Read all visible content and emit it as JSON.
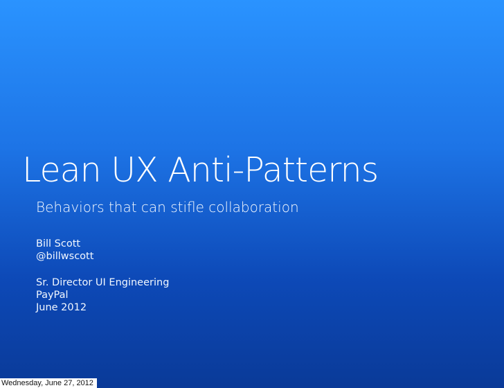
{
  "slide": {
    "title": "Lean UX Anti-Patterns",
    "subtitle": "Behaviors that can stifle collaboration",
    "author": {
      "name": "Bill Scott",
      "handle": "@billwscott"
    },
    "details": {
      "role": "Sr. Director UI Engineering",
      "company": "PayPal",
      "date": "June 2012"
    },
    "footer_date": "Wednesday, June 27, 2012",
    "colors": {
      "background_top": "#2a93ff",
      "background_bottom": "#0a3a98",
      "text": "#ffffff"
    }
  }
}
